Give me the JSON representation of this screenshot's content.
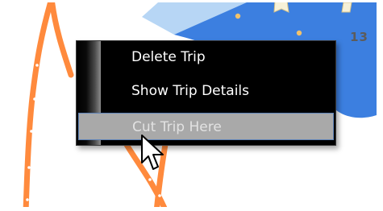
{
  "map": {
    "region_label": "13",
    "colors": {
      "water": "#3c7fe0",
      "water_light": "#b7d6f5",
      "route": "#ff8a3d",
      "route_marker": "#ffffff",
      "poi": "#f2c26b"
    }
  },
  "context_menu": {
    "items": [
      {
        "label": "Delete Trip",
        "state": "normal"
      },
      {
        "label": "Show Trip Details",
        "state": "normal"
      },
      {
        "label": "Cut Trip Here",
        "state": "hovered"
      }
    ]
  },
  "cursor": {
    "icon": "arrow-pointer-icon"
  }
}
